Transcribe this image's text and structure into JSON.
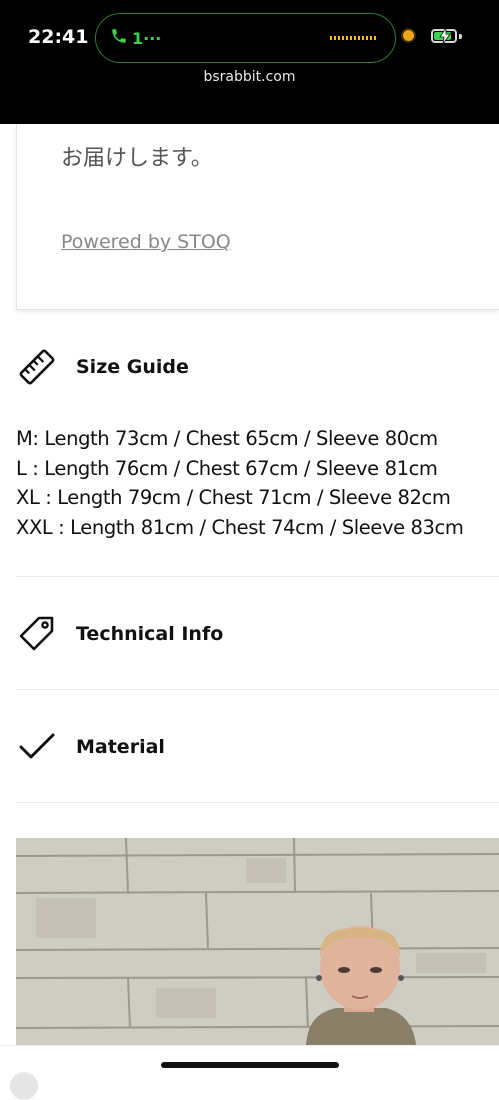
{
  "status_bar": {
    "time": "22:41",
    "call_count": "1···",
    "url": "bsrabbit.com",
    "call_color": "#39d44a",
    "battery_level": 0.85
  },
  "card": {
    "delivery_text": "お届けします。",
    "powered_by": "Powered by STOQ"
  },
  "size_guide": {
    "title": "Size Guide",
    "icon": "ruler-icon",
    "lines": [
      "M: Length 73cm / Chest 65cm / Sleeve 80cm",
      "L : Length 76cm / Chest 67cm / Sleeve 81cm",
      "XL : Length 79cm / Chest 71cm / Sleeve 82cm",
      "XXL : Length 81cm / Chest 74cm / Sleeve 83cm"
    ]
  },
  "technical_info": {
    "title": "Technical Info",
    "icon": "tag-icon"
  },
  "material": {
    "title": "Material",
    "icon": "checkmark-icon"
  },
  "photo": {
    "alt": "model-photo"
  }
}
